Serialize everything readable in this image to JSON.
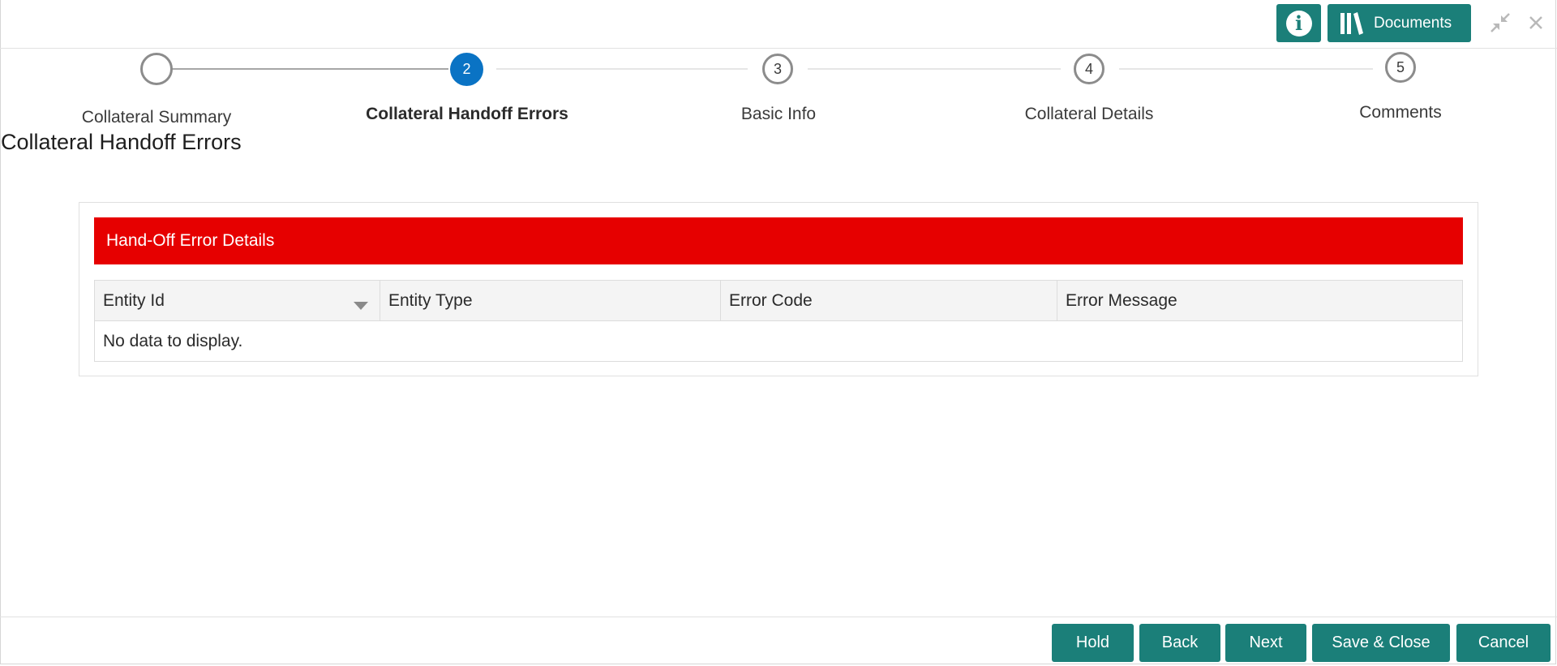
{
  "header": {
    "info_icon": "info-icon",
    "documents_label": "Documents",
    "documents_icon": "library-icon",
    "shrink_icon": "shrink-icon",
    "close_icon": "close-icon",
    "accent_color": "#1b7f79"
  },
  "stepper": {
    "steps": [
      {
        "number": "",
        "label": "Collateral Summary",
        "state": "completed"
      },
      {
        "number": "2",
        "label": "Collateral Handoff Errors",
        "state": "active"
      },
      {
        "number": "3",
        "label": "Basic Info",
        "state": "pending"
      },
      {
        "number": "4",
        "label": "Collateral Details",
        "state": "pending"
      },
      {
        "number": "5",
        "label": "Comments",
        "state": "pending"
      }
    ],
    "active_color": "#0a73c4"
  },
  "page": {
    "title": "Collateral Handoff Errors"
  },
  "panel": {
    "header": "Hand-Off Error Details",
    "header_color": "#e60000",
    "columns": [
      "Entity Id",
      "Entity Type",
      "Error Code",
      "Error Message"
    ],
    "sort_icon": "caret-down-icon",
    "empty_text": "No data to display."
  },
  "footer": {
    "buttons": [
      "Hold",
      "Back",
      "Next",
      "Save & Close",
      "Cancel"
    ]
  }
}
